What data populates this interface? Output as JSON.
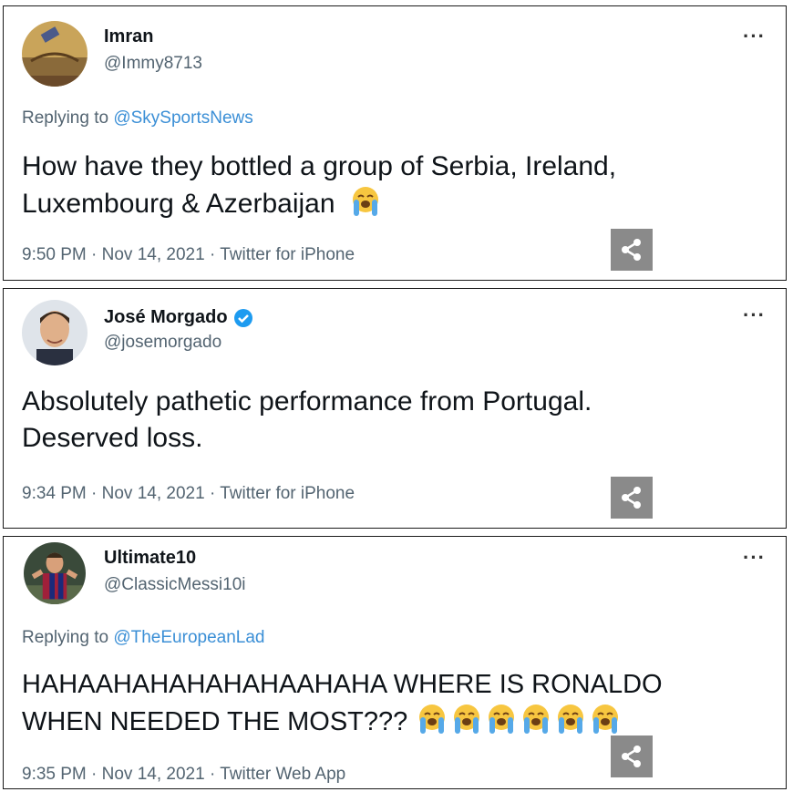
{
  "tweets": [
    {
      "name": "Imran",
      "handle": "@Immy8713",
      "reply_prefix": "Replying to ",
      "reply_to": "@SkySportsNews",
      "text_lines": [
        "How have they bottled a group of Serbia, Ireland,",
        "Luxembourg & Azerbaijan"
      ],
      "meta": "9:50 PM · Nov 14, 2021 · Twitter for iPhone",
      "more": "···",
      "verified": false
    },
    {
      "name": "José Morgado",
      "handle": "@josemorgado",
      "text_lines": [
        "Absolutely pathetic performance from Portugal.",
        "Deserved loss."
      ],
      "meta": "9:34 PM · Nov 14, 2021 · Twitter for iPhone",
      "more": "···",
      "verified": true
    },
    {
      "name": "Ultimate10",
      "handle": "@ClassicMessi10i",
      "reply_prefix": "Replying to ",
      "reply_to": "@TheEuropeanLad",
      "text_lines": [
        "HAHAAHAHAHAHAHAAHAHA WHERE IS RONALDO",
        "WHEN NEEDED THE MOST???"
      ],
      "meta": "9:35 PM · Nov 14, 2021 · Twitter Web App",
      "more": "···",
      "verified": false
    }
  ],
  "icons": {
    "emoji": "loudly-crying-face-icon",
    "share": "share-icon",
    "verified": "verified-badge-icon"
  }
}
